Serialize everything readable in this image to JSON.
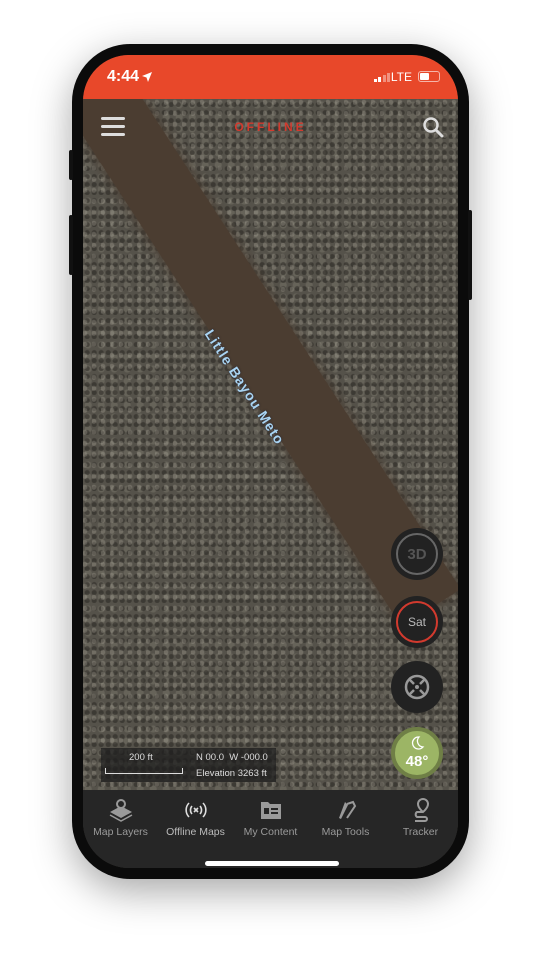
{
  "status_bar": {
    "time": "4:44",
    "network": "LTE",
    "background_color": "#e8482a",
    "battery_fraction": 0.45
  },
  "header": {
    "title": "OFFLINE",
    "title_color": "#d23a2e",
    "menu_icon": "hamburger-icon",
    "search_icon": "search-icon"
  },
  "map": {
    "river_label": "Little Bayou Meto"
  },
  "controls": {
    "three_d_label": "3D",
    "sat_label": "Sat",
    "sat_ring_color": "#d23a2e",
    "locate_icon": "crosshair-icon"
  },
  "weather": {
    "icon": "moon-icon",
    "temperature": "48°",
    "color": "#9cb565"
  },
  "scale_box": {
    "scale": "200 ft",
    "coordinates": "N 00.0  W -000.0",
    "elevation": "Elevation 3263 ft"
  },
  "tabs": [
    {
      "label": "Map Layers",
      "icon": "layers-icon"
    },
    {
      "label": "Offline Maps",
      "icon": "broadcast-icon"
    },
    {
      "label": "My Content",
      "icon": "folder-icon"
    },
    {
      "label": "Map Tools",
      "icon": "tools-icon"
    },
    {
      "label": "Tracker",
      "icon": "route-pin-icon"
    }
  ]
}
